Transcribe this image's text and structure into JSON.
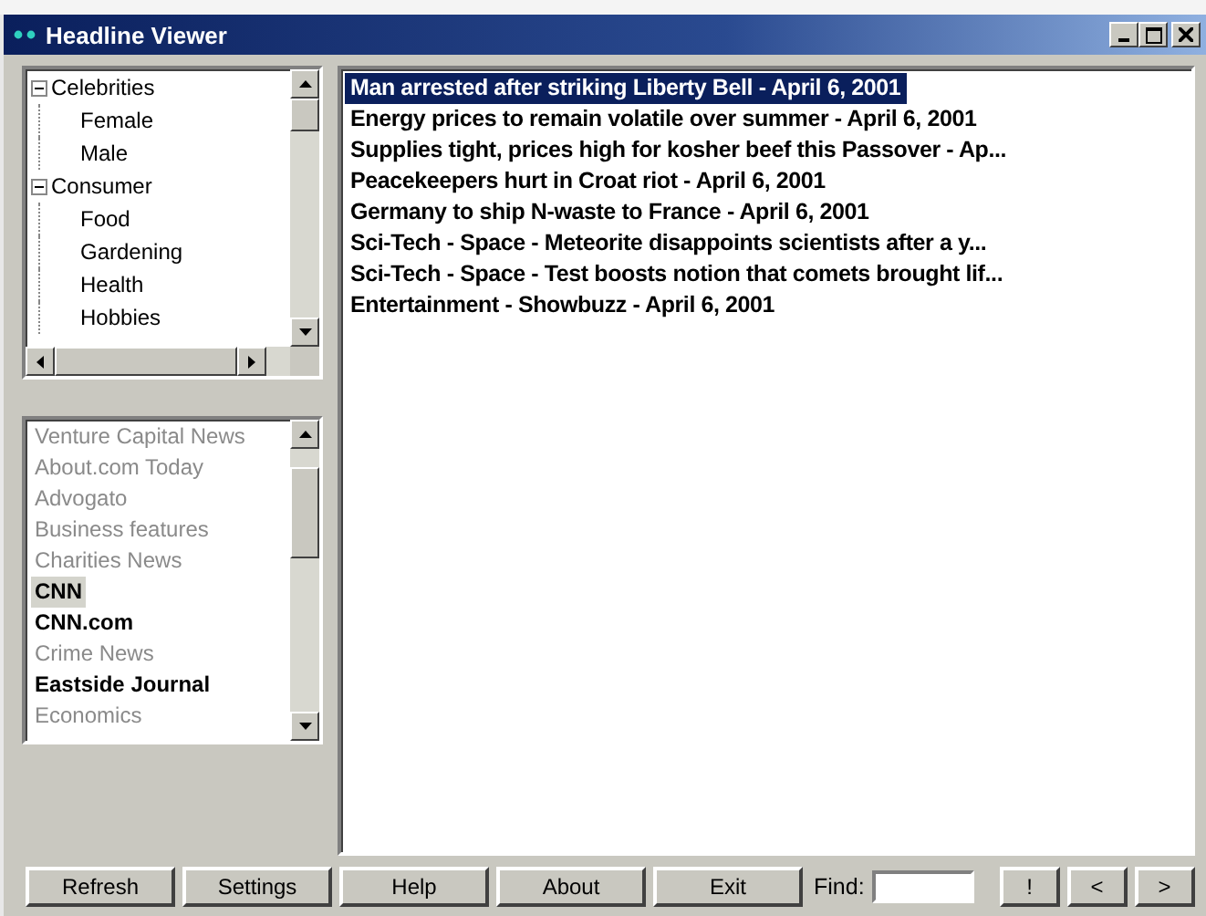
{
  "window": {
    "title": "Headline Viewer"
  },
  "categories": [
    {
      "label": "Celebrities",
      "expanded": true,
      "children": [
        {
          "label": "Female"
        },
        {
          "label": "Male"
        }
      ]
    },
    {
      "label": "Consumer",
      "expanded": true,
      "children": [
        {
          "label": "Food"
        },
        {
          "label": "Gardening"
        },
        {
          "label": "Health"
        },
        {
          "label": "Hobbies"
        }
      ]
    }
  ],
  "sources": [
    {
      "label": "Venture Capital News",
      "subscribed": false,
      "selected": false
    },
    {
      "label": "About.com Today",
      "subscribed": false,
      "selected": false
    },
    {
      "label": "Advogato",
      "subscribed": false,
      "selected": false
    },
    {
      "label": "Business features",
      "subscribed": false,
      "selected": false
    },
    {
      "label": "Charities News",
      "subscribed": false,
      "selected": false
    },
    {
      "label": "CNN",
      "subscribed": true,
      "selected": true
    },
    {
      "label": "CNN.com",
      "subscribed": true,
      "selected": false
    },
    {
      "label": "Crime News",
      "subscribed": false,
      "selected": false
    },
    {
      "label": "Eastside Journal",
      "subscribed": true,
      "selected": false
    },
    {
      "label": "Economics",
      "subscribed": false,
      "selected": false
    }
  ],
  "headlines": [
    {
      "text": "Man arrested after striking Liberty Bell - April  6, 2001",
      "selected": true
    },
    {
      "text": "Energy prices to remain volatile over summer - April  6, 2001",
      "selected": false
    },
    {
      "text": "Supplies tight, prices high for kosher beef this Passover - Ap...",
      "selected": false
    },
    {
      "text": "Peacekeepers hurt in Croat riot - April  6, 2001",
      "selected": false
    },
    {
      "text": "Germany to ship N-waste to France - April  6, 2001",
      "selected": false
    },
    {
      "text": "Sci-Tech - Space - Meteorite disappoints scientists after a y...",
      "selected": false
    },
    {
      "text": "Sci-Tech - Space - Test boosts notion that comets brought lif...",
      "selected": false
    },
    {
      "text": "Entertainment - Showbuzz - April  6, 2001",
      "selected": false
    }
  ],
  "buttons": [
    "Refresh",
    "Settings",
    "Help",
    "About",
    "Exit"
  ],
  "find": {
    "label": "Find:"
  },
  "nav_buttons": [
    "!",
    "<",
    ">"
  ]
}
